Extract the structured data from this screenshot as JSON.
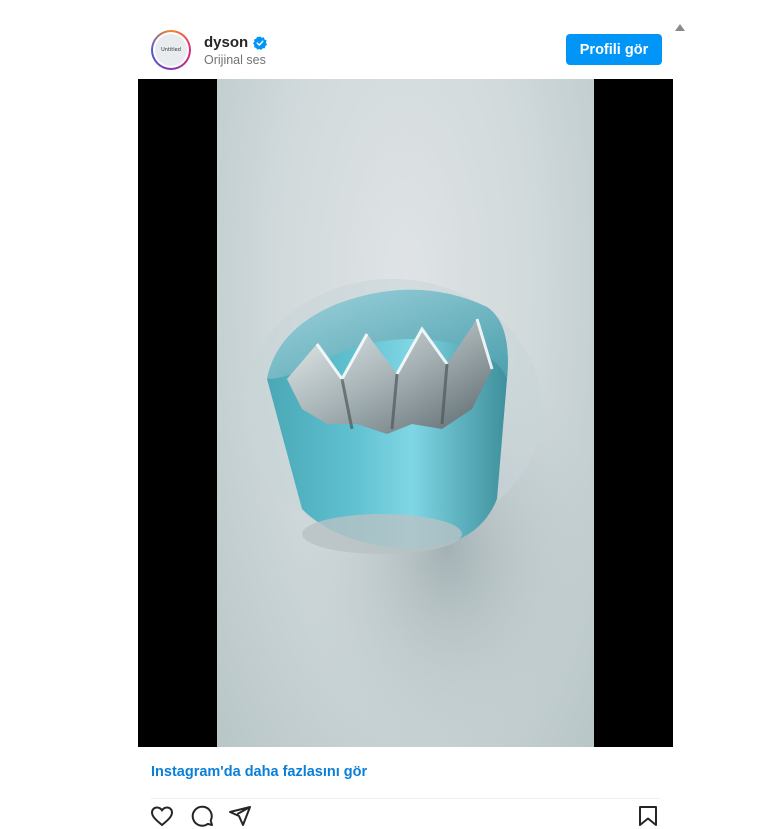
{
  "post": {
    "username": "dyson",
    "subtitle": "Orijinal ses",
    "avatar_text": "Untitled",
    "verified": true,
    "profile_button_label": "Profili gör",
    "more_link_text": "Instagram'da daha fazlasını gör"
  },
  "icons": {
    "verified": "verified-badge-icon",
    "like": "heart-icon",
    "comment": "comment-icon",
    "share": "share-icon",
    "save": "bookmark-icon",
    "scroll_up": "scroll-up-arrow-icon"
  },
  "colors": {
    "accent": "#0095f6",
    "link": "#0a7fd8",
    "text": "#262626",
    "muted": "#737373",
    "video_background": "#000000"
  }
}
